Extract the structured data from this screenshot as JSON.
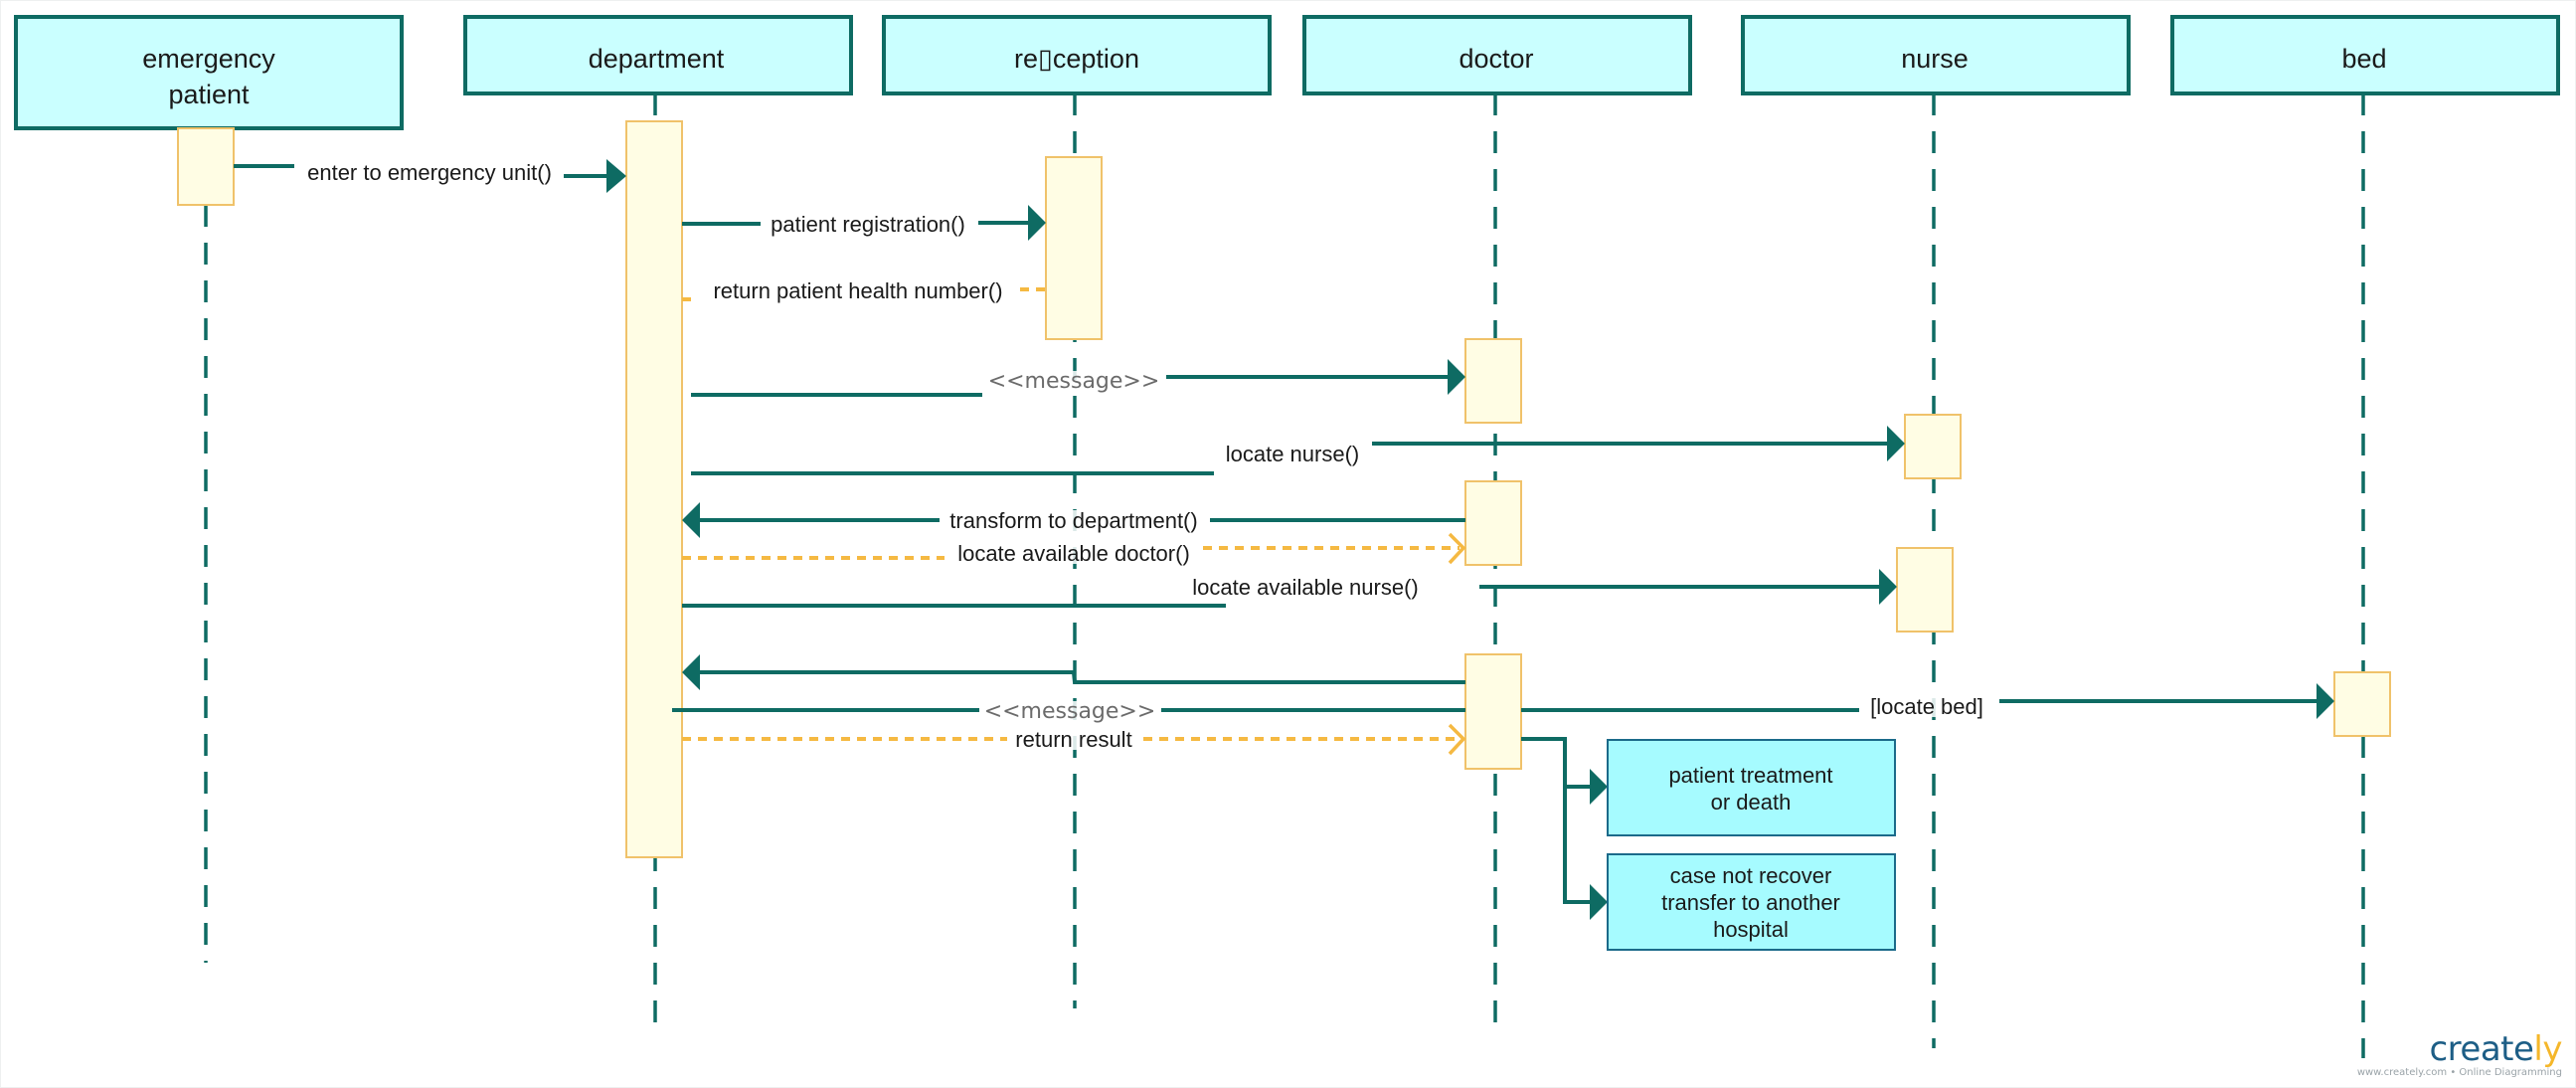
{
  "diagram": {
    "type": "UML sequence diagram",
    "colors": {
      "lifeline_stroke": "#0e6b63",
      "lifeline_fill": "#caffff",
      "activation_fill": "#fffde4",
      "activation_stroke": "#f0c26a",
      "sync_message": "#0e6b63",
      "return_message": "#f5b942",
      "note_fill": "#a6fbff",
      "note_stroke": "#1b6a8a"
    },
    "lifelines": [
      {
        "id": "emergency-patient",
        "lines": [
          "emergency",
          "patient"
        ]
      },
      {
        "id": "department",
        "lines": [
          "department"
        ]
      },
      {
        "id": "reception",
        "lines": [
          "re▯ception"
        ]
      },
      {
        "id": "doctor",
        "lines": [
          "doctor"
        ]
      },
      {
        "id": "nurse",
        "lines": [
          "nurse"
        ]
      },
      {
        "id": "bed",
        "lines": [
          "bed"
        ]
      }
    ],
    "messages": [
      {
        "id": "m1",
        "label": "enter to emergency unit()",
        "from": "emergency-patient",
        "to": "department",
        "kind": "sync"
      },
      {
        "id": "m2",
        "label": "patient registration()",
        "from": "department",
        "to": "reception",
        "kind": "sync"
      },
      {
        "id": "m3",
        "label": "return patient health number()",
        "from": "reception",
        "to": "department",
        "kind": "return"
      },
      {
        "id": "m4",
        "label": "<<message>>",
        "from": "department",
        "to": "doctor",
        "kind": "sync",
        "stereotype": true
      },
      {
        "id": "m5",
        "label": "locate nurse()",
        "from": "department",
        "to": "nurse",
        "kind": "sync"
      },
      {
        "id": "m6",
        "label": "transform to department()",
        "from": "doctor",
        "to": "department",
        "kind": "sync"
      },
      {
        "id": "m7",
        "label": "locate available doctor()",
        "from": "department",
        "to": "doctor",
        "kind": "return"
      },
      {
        "id": "m8",
        "label": "locate available nurse()",
        "from": "department",
        "to": "nurse",
        "kind": "sync"
      },
      {
        "id": "m9",
        "label": "",
        "from": "doctor",
        "to": "department",
        "kind": "sync"
      },
      {
        "id": "m10",
        "label": "<<message>>",
        "from": "department",
        "to": "doctor",
        "kind": "sync",
        "stereotype": true
      },
      {
        "id": "m11",
        "label": "[locate bed]",
        "from": "doctor",
        "to": "bed",
        "kind": "sync"
      },
      {
        "id": "m12",
        "label": "return result",
        "from": "department",
        "to": "doctor",
        "kind": "return"
      }
    ],
    "notes": [
      {
        "id": "outcome-treatment",
        "lines": [
          "patient treatment",
          "or death"
        ]
      },
      {
        "id": "outcome-transfer",
        "lines": [
          "case not recover",
          "transfer to another",
          "hospital"
        ]
      }
    ]
  },
  "watermark": {
    "brand_main": "create",
    "brand_accent": "ly",
    "tagline": "www.creately.com • Online Diagramming"
  }
}
